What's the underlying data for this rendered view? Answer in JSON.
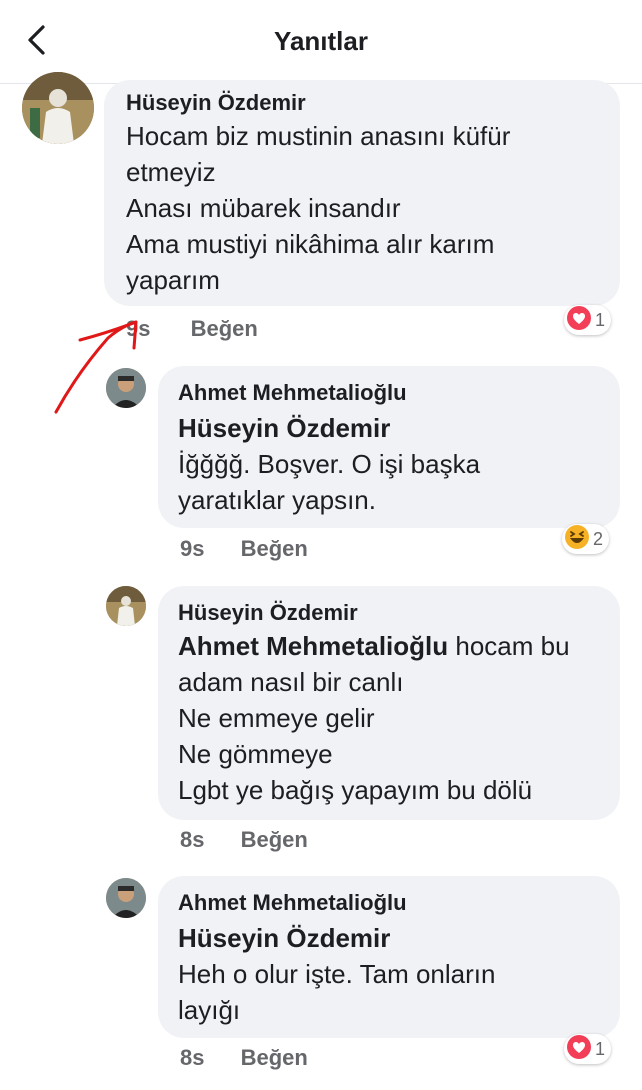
{
  "header": {
    "title": "Yanıtlar"
  },
  "comments": [
    {
      "author": "Hüseyin Özdemir",
      "lines": [
        "Hocam biz mustinin anasını küfür",
        "etmeyiz",
        "Anası mübarek insandır",
        "Ama mustiyi nikâhima alır karım",
        "yaparım"
      ],
      "time": "9s",
      "like": "Beğen",
      "reaction": {
        "icon": "heart-reaction-icon",
        "color": "#f33e58",
        "count": "1"
      }
    },
    {
      "author": "Ahmet Mehmetalioğlu",
      "mention": "Hüseyin Özdemir",
      "lines": [
        "İğğğğ. Boşver. O işi başka",
        "yaratıklar yapsın."
      ],
      "time": "9s",
      "like": "Beğen",
      "reaction": {
        "icon": "laughing-emoji-icon",
        "color": "#f7b125",
        "count": "2"
      }
    },
    {
      "author": "Hüseyin Özdemir",
      "mention": "Ahmet Mehmetalioğlu",
      "mention_rest": " hocam bu",
      "lines": [
        "adam nasıl bir canlı",
        "Ne emmeye gelir",
        "Ne gömmeye",
        "Lgbt ye bağış yapayım bu dölü"
      ],
      "time": "8s",
      "like": "Beğen"
    },
    {
      "author": "Ahmet Mehmetalioğlu",
      "mention": "Hüseyin Özdemir",
      "lines": [
        "Heh o olur işte. Tam onların",
        "layığı"
      ],
      "time": "8s",
      "like": "Beğen",
      "reaction": {
        "icon": "heart-reaction-icon",
        "color": "#f33e58",
        "count": "1"
      }
    }
  ]
}
